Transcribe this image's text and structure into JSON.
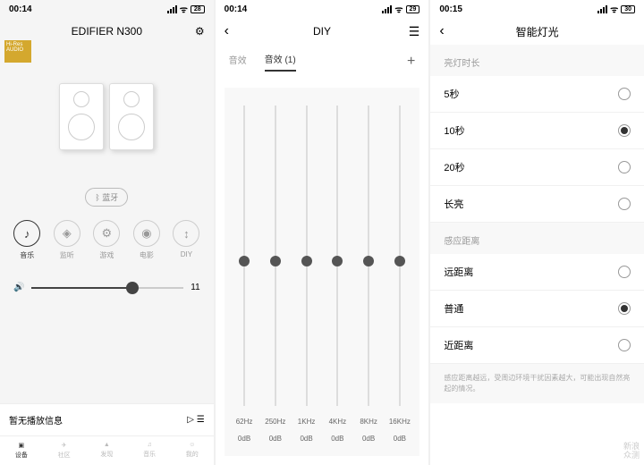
{
  "s1": {
    "time": "00:14",
    "bat": "28",
    "title": "EDIFIER N300",
    "hires": "Hi-Res AUDIO",
    "bt": "蓝牙",
    "modes": [
      {
        "l": "音乐",
        "i": "♪"
      },
      {
        "l": "监听",
        "i": "◈"
      },
      {
        "l": "游戏",
        "i": "⚙"
      },
      {
        "l": "电影",
        "i": "◉"
      },
      {
        "l": "DIY",
        "i": "↕"
      }
    ],
    "vol": "11",
    "now": "暂无播放信息",
    "tabs": [
      {
        "l": "设备"
      },
      {
        "l": "社区"
      },
      {
        "l": "发现"
      },
      {
        "l": "音乐"
      },
      {
        "l": "我的"
      }
    ]
  },
  "s2": {
    "time": "00:14",
    "bat": "29",
    "title": "DIY",
    "t1": "音效",
    "t2": "音效 (1)",
    "eq": [
      {
        "f": "62Hz",
        "d": "0dB"
      },
      {
        "f": "250Hz",
        "d": "0dB"
      },
      {
        "f": "1KHz",
        "d": "0dB"
      },
      {
        "f": "4KHz",
        "d": "0dB"
      },
      {
        "f": "8KHz",
        "d": "0dB"
      },
      {
        "f": "16KHz",
        "d": "0dB"
      }
    ]
  },
  "s3": {
    "time": "00:15",
    "bat": "30",
    "title": "智能灯光",
    "sec1": "亮灯时长",
    "opts1": [
      {
        "l": "5秒",
        "s": false
      },
      {
        "l": "10秒",
        "s": true
      },
      {
        "l": "20秒",
        "s": false
      },
      {
        "l": "长亮",
        "s": false
      }
    ],
    "sec2": "感应距离",
    "opts2": [
      {
        "l": "远距离",
        "s": false
      },
      {
        "l": "普通",
        "s": true
      },
      {
        "l": "近距离",
        "s": false
      }
    ],
    "note": "感应距离越远，受周边环境干扰因素越大，可能出现自然亮起的情况。"
  },
  "wm": {
    "l1": "新浪",
    "l2": "众测"
  }
}
